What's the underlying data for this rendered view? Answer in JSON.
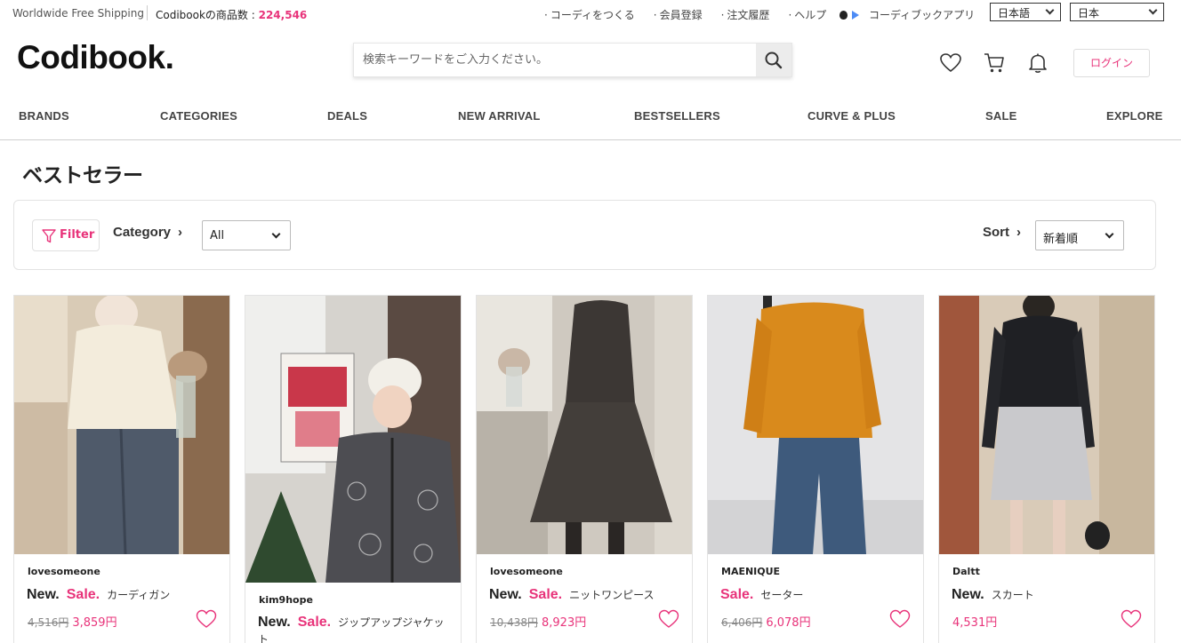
{
  "topbar": {
    "shipping": "Worldwide Free Shipping",
    "count_label": "Codibookの商品数 : ",
    "count_value": "224,546",
    "links": [
      "コーディをつくる",
      "会員登録",
      "注文履歴",
      "ヘルプ"
    ],
    "app": "コーディブックアプリ",
    "language": "日本語",
    "region": "日本"
  },
  "header": {
    "logo": "Codibook.",
    "search_placeholder": "検索キーワードをご入力ください。",
    "login": "ログイン"
  },
  "nav": [
    "BRANDS",
    "CATEGORIES",
    "DEALS",
    "NEW ARRIVAL",
    "BESTSELLERS",
    "CURVE & PLUS",
    "SALE",
    "EXPLORE"
  ],
  "page": {
    "title": "ベストセラー"
  },
  "filters": {
    "filter_label": "Filter",
    "category_label": "Category",
    "category_value": "All",
    "sort_label": "Sort",
    "sort_value": "新着順",
    "arrow": "›"
  },
  "products": [
    {
      "brand": "lovesomeone",
      "new": "New.",
      "sale": "Sale.",
      "name": "カーディガン",
      "original_price": "4,516円",
      "price": "3,859円"
    },
    {
      "brand": "kim9hope",
      "new": "New.",
      "sale": "Sale.",
      "name": "ジップアップジャケット",
      "original_price": "",
      "price": ""
    },
    {
      "brand": "lovesomeone",
      "new": "New.",
      "sale": "Sale.",
      "name": "ニットワンピース",
      "original_price": "10,438円",
      "price": "8,923円"
    },
    {
      "brand": "MAENIQUE",
      "new": "",
      "sale": "Sale.",
      "name": "セーター",
      "original_price": "6,406円",
      "price": "6,078円"
    },
    {
      "brand": "Daltt",
      "new": "New.",
      "sale": "",
      "name": "スカート",
      "original_price": "",
      "price": "4,531円"
    }
  ],
  "colors": {
    "accent": "#e8337a"
  },
  "icons": [
    "search-icon",
    "heart-icon",
    "cart-icon",
    "bell-icon",
    "filter-icon",
    "apple-icon",
    "play-store-icon",
    "chevron-down-icon"
  ]
}
